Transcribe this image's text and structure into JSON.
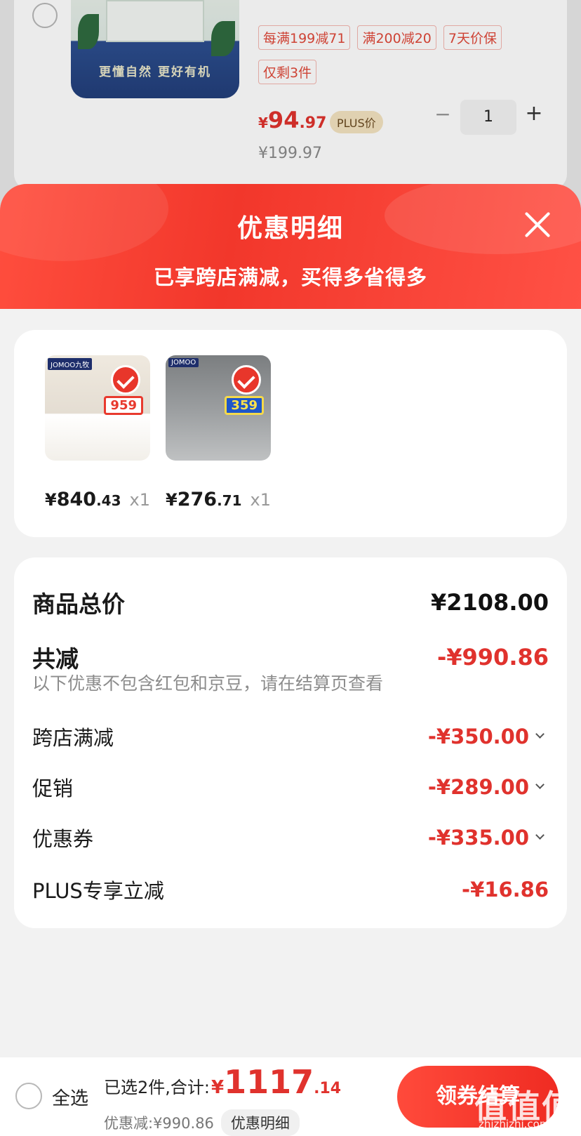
{
  "background_item": {
    "tags": [
      "每满199减71",
      "满200减20",
      "7天价保",
      "仅剩3件"
    ],
    "image_slogan": "更懂自然 更好有机",
    "price_symbol": "¥",
    "price_int": "94",
    "price_dec": ".97",
    "plus_badge": "PLUS价",
    "quantity": "1",
    "original_price": "¥199.97"
  },
  "sheet": {
    "title": "优惠明细",
    "subtitle": "已享跨店满减，买得多省得多"
  },
  "products": [
    {
      "brand": "JOMOO九牧",
      "tag_price": "959",
      "price_symbol": "¥",
      "price_int": "840",
      "price_dec": ".43",
      "count": "x1"
    },
    {
      "brand": "JOMOO",
      "tag_price": "359",
      "price_symbol": "¥",
      "price_int": "276",
      "price_dec": ".71",
      "count": "x1"
    }
  ],
  "summary": {
    "total_label": "商品总价",
    "total_value": "¥2108.00",
    "reduce_label": "共减",
    "reduce_value": "-¥990.86",
    "note": "以下优惠不包含红包和京豆，请在结算页查看",
    "items": [
      {
        "label": "跨店满减",
        "value": "-¥350.00",
        "expandable": true
      },
      {
        "label": "促销",
        "value": "-¥289.00",
        "expandable": true
      },
      {
        "label": "优惠券",
        "value": "-¥335.00",
        "expandable": true
      },
      {
        "label": "PLUS专享立减",
        "value": "-¥16.86",
        "expandable": false
      }
    ]
  },
  "bottom_bar": {
    "select_all": "全选",
    "selected_text": "已选2件,合计:",
    "total_symbol": "¥",
    "total_int": "1117",
    "total_dec": ".14",
    "discount_text": "优惠减:¥990.86",
    "detail_button": "优惠明细",
    "checkout_button": "领券结算"
  },
  "watermark": {
    "text": "值值值",
    "url": "zhizhizhi.com"
  },
  "colors": {
    "accent": "#e0322d",
    "header": "#f2372b"
  }
}
